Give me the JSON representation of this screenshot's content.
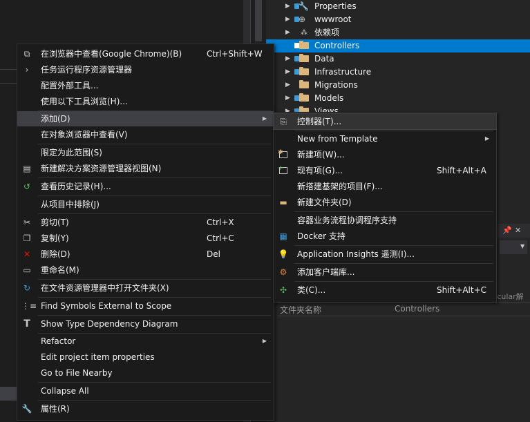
{
  "solution_tree": [
    {
      "label": "Properties",
      "icon": "wrench-icon",
      "lock": true,
      "selected": false
    },
    {
      "label": "wwwroot",
      "icon": "globe-icon",
      "lock": true,
      "selected": false
    },
    {
      "label": "依赖项",
      "icon": "dependencies-icon",
      "lock": false,
      "selected": false
    },
    {
      "label": "Controllers",
      "icon": "folder-icon",
      "lock": true,
      "selected": true
    },
    {
      "label": "Data",
      "icon": "folder-icon",
      "lock": true,
      "selected": false
    },
    {
      "label": "Infrastructure",
      "icon": "folder-icon",
      "lock": true,
      "selected": false
    },
    {
      "label": "Migrations",
      "icon": "folder-icon",
      "lock": false,
      "selected": false
    },
    {
      "label": "Models",
      "icon": "folder-icon",
      "lock": true,
      "selected": false
    },
    {
      "label": "Views",
      "icon": "folder-icon",
      "lock": true,
      "selected": false
    }
  ],
  "properties": {
    "header_fragment": "tcular解",
    "row_key": "文件夹名称",
    "row_value": "Controllers"
  },
  "context_menu": {
    "items": [
      {
        "label": "在浏览器中查看(Google Chrome)(B)",
        "shortcut": "Ctrl+Shift+W",
        "icon": "browser-view-icon"
      },
      {
        "label": "任务运行程序资源管理器",
        "shortcut": "",
        "icon": "task-runner-icon"
      },
      {
        "label": "配置外部工具...",
        "shortcut": "",
        "icon": ""
      },
      {
        "label": "使用以下工具浏览(H)...",
        "shortcut": "",
        "icon": ""
      },
      {
        "label": "添加(D)",
        "shortcut": "",
        "icon": "",
        "submenu": true
      },
      {
        "label": "在对象浏览器中查看(V)",
        "shortcut": "",
        "icon": ""
      },
      {
        "label": "限定为此范围(S)",
        "shortcut": "",
        "icon": ""
      },
      {
        "label": "新建解决方案资源管理器视图(N)",
        "shortcut": "",
        "icon": "new-view-icon"
      },
      {
        "label": "查看历史记录(H)...",
        "shortcut": "",
        "icon": "history-icon"
      },
      {
        "label": "从项目中排除(J)",
        "shortcut": "",
        "icon": ""
      },
      {
        "label": "剪切(T)",
        "shortcut": "Ctrl+X",
        "icon": "scissors-icon"
      },
      {
        "label": "复制(Y)",
        "shortcut": "Ctrl+C",
        "icon": "copy-icon"
      },
      {
        "label": "删除(D)",
        "shortcut": "Del",
        "icon": "delete-x-icon"
      },
      {
        "label": "重命名(M)",
        "shortcut": "",
        "icon": "rename-icon"
      },
      {
        "label": "在文件资源管理器中打开文件夹(X)",
        "shortcut": "",
        "icon": "refresh-arrow-icon"
      },
      {
        "label": "Find Symbols External to Scope",
        "shortcut": "",
        "icon": "find-symbols-icon"
      },
      {
        "label": "Show Type Dependency Diagram",
        "shortcut": "",
        "icon": "type-diagram-icon"
      },
      {
        "label": "Refactor",
        "shortcut": "",
        "icon": "",
        "submenu": true
      },
      {
        "label": "Edit project item properties",
        "shortcut": "",
        "icon": ""
      },
      {
        "label": "Go to File Nearby",
        "shortcut": "",
        "icon": ""
      },
      {
        "label": "Collapse All",
        "shortcut": "",
        "icon": ""
      },
      {
        "label": "属性(R)",
        "shortcut": "",
        "icon": "wrench-icon"
      }
    ]
  },
  "add_submenu": {
    "items": [
      {
        "label": "控制器(T)...",
        "shortcut": "",
        "icon": "controller-icon"
      },
      {
        "label": "New from Template",
        "shortcut": "",
        "icon": "",
        "submenu": true
      },
      {
        "label": "新建项(W)...",
        "shortcut": "",
        "icon": "new-item-icon"
      },
      {
        "label": "现有项(G)...",
        "shortcut": "Shift+Alt+A",
        "icon": "existing-item-icon"
      },
      {
        "label": "新搭建基架的项目(F)...",
        "shortcut": "",
        "icon": ""
      },
      {
        "label": "新建文件夹(D)",
        "shortcut": "",
        "icon": "new-folder-icon"
      },
      {
        "label": "容器业务流程协调程序支持",
        "shortcut": "",
        "icon": ""
      },
      {
        "label": "Docker 支持",
        "shortcut": "",
        "icon": "docker-icon"
      },
      {
        "label": "Application Insights 遥测(I)...",
        "shortcut": "",
        "icon": "insights-bulb-icon"
      },
      {
        "label": "添加客户端库...",
        "shortcut": "",
        "icon": "client-library-icon"
      },
      {
        "label": "类(C)...",
        "shortcut": "Shift+Alt+C",
        "icon": "class-icon"
      }
    ]
  }
}
